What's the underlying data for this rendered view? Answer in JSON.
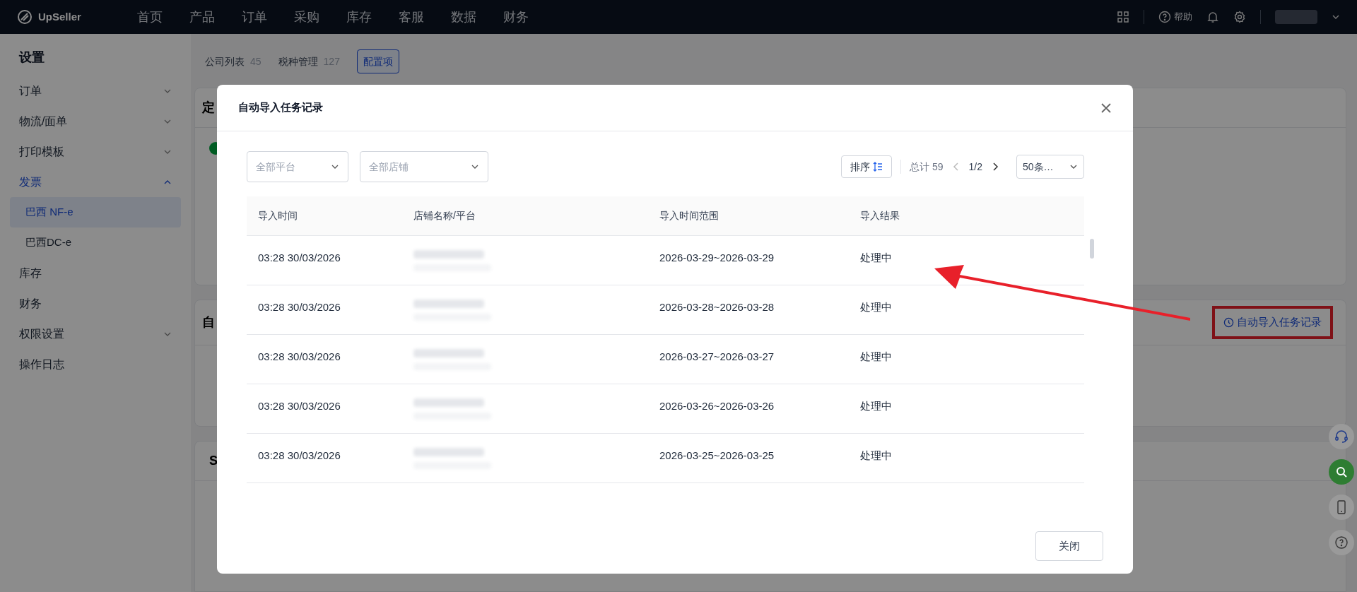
{
  "topbar": {
    "logo": "UpSeller",
    "nav": [
      {
        "label": "首页",
        "selected": false
      },
      {
        "label": "产品",
        "selected": false
      },
      {
        "label": "订单",
        "selected": false
      },
      {
        "label": "采购",
        "selected": false
      },
      {
        "label": "库存",
        "selected": false
      },
      {
        "label": "客服",
        "selected": false
      },
      {
        "label": "数据",
        "selected": false
      },
      {
        "label": "财务",
        "selected": false
      }
    ],
    "help": "帮助"
  },
  "sidebar": {
    "title": "设置",
    "items": [
      {
        "label": "订单",
        "kind": "group",
        "expanded": false,
        "selected": false
      },
      {
        "label": "物流/面单",
        "kind": "group",
        "expanded": false,
        "selected": false
      },
      {
        "label": "打印模板",
        "kind": "group",
        "expanded": false,
        "selected": false
      },
      {
        "label": "发票",
        "kind": "group",
        "expanded": true,
        "selected": true,
        "children": [
          {
            "label": "巴西 NF-e",
            "selected": true
          },
          {
            "label": "巴西DC-e",
            "selected": false
          }
        ]
      },
      {
        "label": "库存",
        "kind": "link",
        "selected": false
      },
      {
        "label": "财务",
        "kind": "link",
        "selected": false
      },
      {
        "label": "权限设置",
        "kind": "group",
        "expanded": false,
        "selected": false
      },
      {
        "label": "操作日志",
        "kind": "link",
        "selected": false
      }
    ]
  },
  "tabs": [
    {
      "label": "公司列表",
      "count": "45",
      "selected": false
    },
    {
      "label": "税种管理",
      "count": "127",
      "selected": false
    },
    {
      "label": "配置项",
      "selected": true
    }
  ],
  "cards": [
    {
      "title": "定"
    },
    {
      "title": "自"
    },
    {
      "title": "S"
    }
  ],
  "auto_import_button": "自动导入任务记录",
  "modal": {
    "title": "自动导入任务记录",
    "filters": [
      {
        "placeholder": "全部平台"
      },
      {
        "placeholder": "全部店铺"
      }
    ],
    "sort": "排序",
    "total": "总计 59",
    "page": "1/2",
    "page_size": "50条…",
    "columns": [
      "导入时间",
      "店铺名称/平台",
      "导入时间范围",
      "导入结果"
    ],
    "rows": [
      {
        "time": "03:28 30/03/2026",
        "range": "2026-03-29~2026-03-29",
        "result": "处理中"
      },
      {
        "time": "03:28 30/03/2026",
        "range": "2026-03-28~2026-03-28",
        "result": "处理中"
      },
      {
        "time": "03:28 30/03/2026",
        "range": "2026-03-27~2026-03-27",
        "result": "处理中"
      },
      {
        "time": "03:28 30/03/2026",
        "range": "2026-03-26~2026-03-26",
        "result": "处理中"
      },
      {
        "time": "03:28 30/03/2026",
        "range": "2026-03-25~2026-03-25",
        "result": "处理中"
      }
    ],
    "close_button": "关闭"
  }
}
